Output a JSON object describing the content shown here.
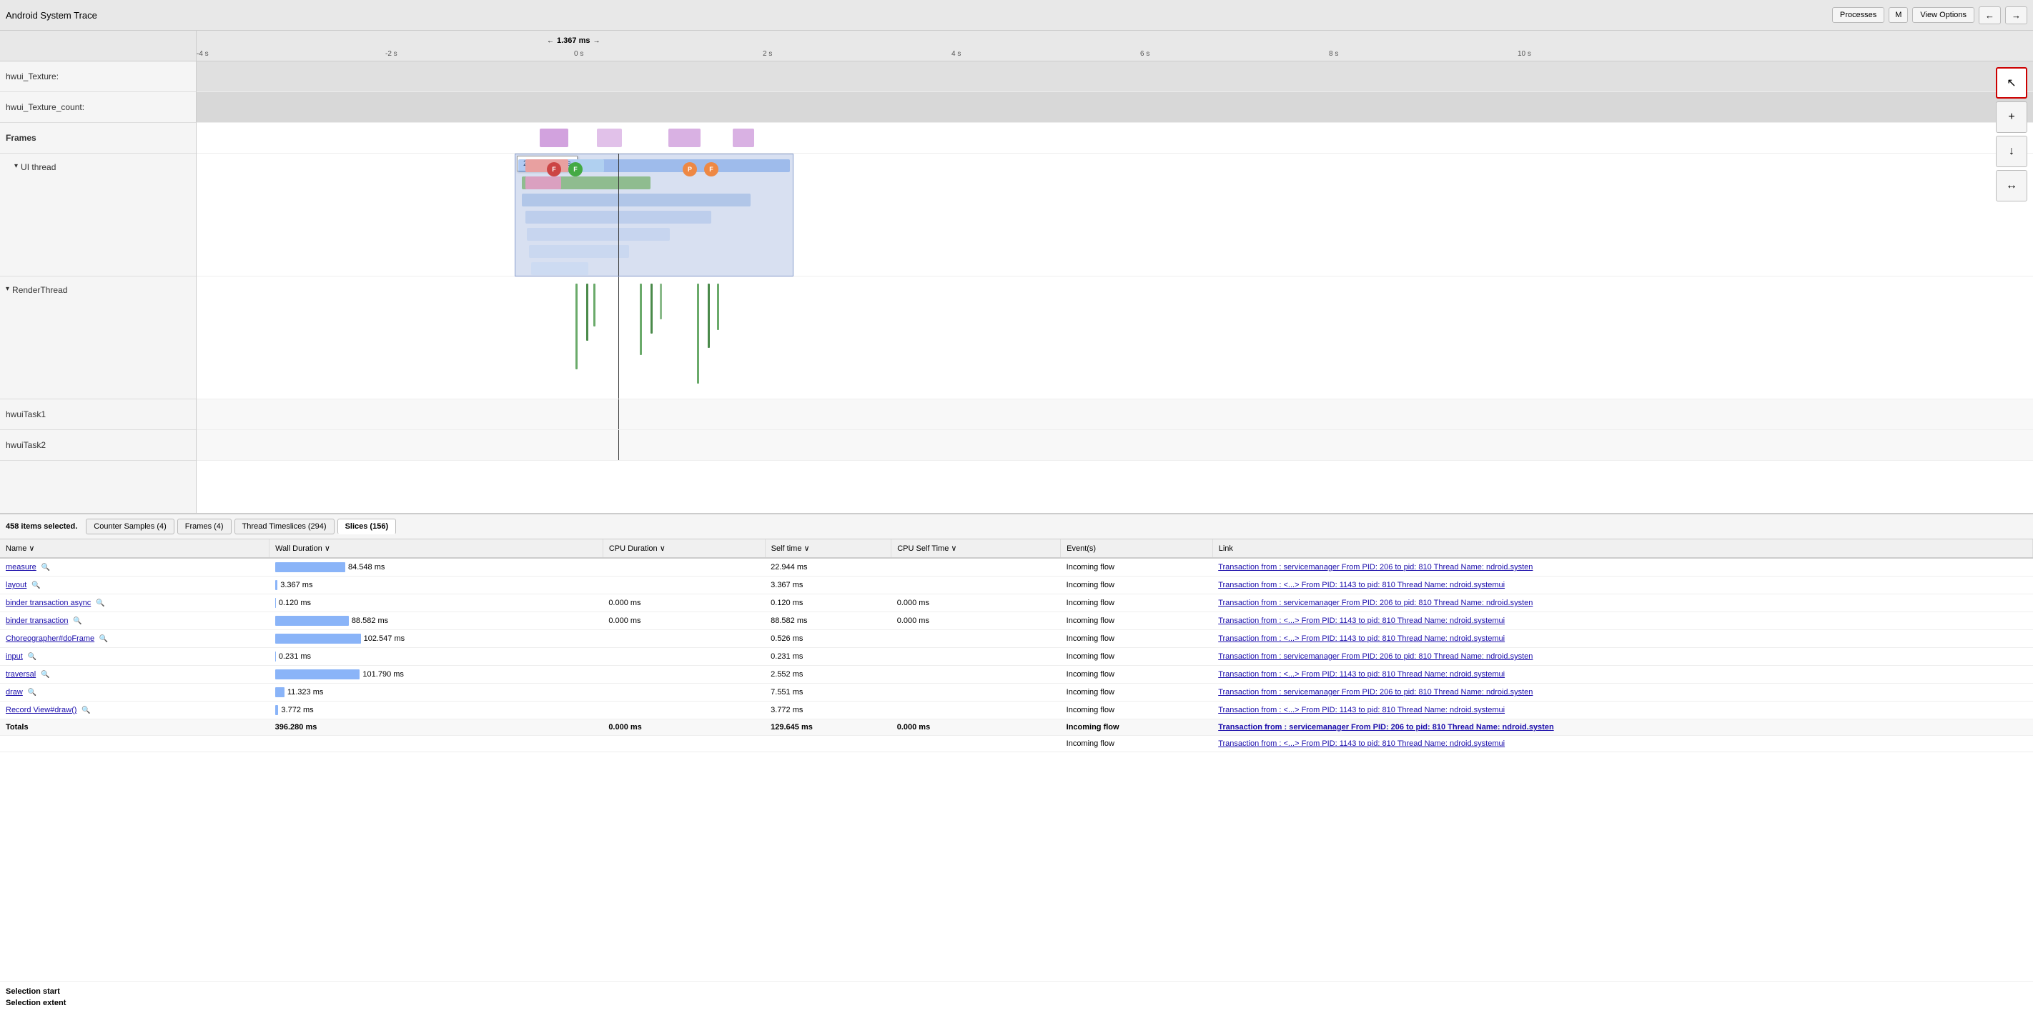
{
  "app": {
    "title": "Android System Trace"
  },
  "topbar": {
    "processes_btn": "Processes",
    "m_btn": "M",
    "view_options_btn": "View Options",
    "back_btn": "←",
    "forward_btn": "→"
  },
  "ruler": {
    "ticks": [
      "-4 s",
      "-2 s",
      "0 s",
      "2 s",
      "4 s",
      "6 s",
      "8 s",
      "10 s"
    ]
  },
  "tracks": [
    {
      "label": "hwui_Texture:",
      "height": "normal"
    },
    {
      "label": "hwui_Texture_count:",
      "height": "normal"
    },
    {
      "label": "Frames",
      "height": "frames",
      "bold": true
    },
    {
      "label": "UI thread",
      "height": "normal",
      "indent": true,
      "arrow": "▾"
    },
    {
      "label": "RenderThread",
      "height": "render",
      "arrow": "▾"
    },
    {
      "label": "hwuiTask1",
      "height": "normal"
    },
    {
      "label": "hwuiTask2",
      "height": "normal"
    }
  ],
  "selection": {
    "summary": "458 items selected.",
    "tabs": [
      {
        "label": "Counter Samples (4)",
        "active": false
      },
      {
        "label": "Frames (4)",
        "active": false
      },
      {
        "label": "Thread Timeslices (294)",
        "active": false
      },
      {
        "label": "Slices (156)",
        "active": true
      }
    ]
  },
  "table": {
    "columns": [
      {
        "label": "Name",
        "sort": true
      },
      {
        "label": "Wall Duration",
        "sort": true
      },
      {
        "label": "CPU Duration",
        "sort": true
      },
      {
        "label": "Self time",
        "sort": true
      },
      {
        "label": "CPU Self Time",
        "sort": true
      },
      {
        "label": "Event(s)",
        "sort": false
      },
      {
        "label": "Link",
        "sort": false
      }
    ],
    "rows": [
      {
        "name": "measure",
        "wall": "84.548 ms",
        "cpu": "",
        "self": "22.944 ms",
        "cpu_self": "",
        "event": "Incoming flow",
        "link": "Transaction from : servicemanager From PID: 206 to pid: 810 Thread Name: ndroid.systen",
        "bar_pct": 82
      },
      {
        "name": "layout",
        "wall": "3.367 ms",
        "cpu": "",
        "self": "3.367 ms",
        "cpu_self": "",
        "event": "Incoming flow",
        "link": "Transaction from : <...> From PID: 1143 to pid: 810 Thread Name: ndroid.systemui",
        "bar_pct": 3
      },
      {
        "name": "binder transaction async",
        "wall": "0.120 ms",
        "cpu": "0.000 ms",
        "self": "0.120 ms",
        "cpu_self": "0.000 ms",
        "event": "Incoming flow",
        "link": "Transaction from : servicemanager From PID: 206 to pid: 810 Thread Name: ndroid.systen",
        "bar_pct": 1
      },
      {
        "name": "binder transaction",
        "wall": "88.582 ms",
        "cpu": "0.000 ms",
        "self": "88.582 ms",
        "cpu_self": "0.000 ms",
        "event": "Incoming flow",
        "link": "Transaction from : <...> From PID: 1143 to pid: 810 Thread Name: ndroid.systemui",
        "bar_pct": 86
      },
      {
        "name": "Choreographer#doFrame",
        "wall": "102.547 ms",
        "cpu": "",
        "self": "0.526 ms",
        "cpu_self": "",
        "event": "Incoming flow",
        "link": "Transaction from : <...> From PID: 1143 to pid: 810 Thread Name: ndroid.systemui",
        "bar_pct": 100
      },
      {
        "name": "input",
        "wall": "0.231 ms",
        "cpu": "",
        "self": "0.231 ms",
        "cpu_self": "",
        "event": "Incoming flow",
        "link": "Transaction from : servicemanager From PID: 206 to pid: 810 Thread Name: ndroid.systen",
        "bar_pct": 1
      },
      {
        "name": "traversal",
        "wall": "101.790 ms",
        "cpu": "",
        "self": "2.552 ms",
        "cpu_self": "",
        "event": "Incoming flow",
        "link": "Transaction from : <...> From PID: 1143 to pid: 810 Thread Name: ndroid.systemui",
        "bar_pct": 99
      },
      {
        "name": "draw",
        "wall": "11.323 ms",
        "cpu": "",
        "self": "7.551 ms",
        "cpu_self": "",
        "event": "Incoming flow",
        "link": "Transaction from : servicemanager From PID: 206 to pid: 810 Thread Name: ndroid.systen",
        "bar_pct": 11
      },
      {
        "name": "Record View#draw()",
        "wall": "3.772 ms",
        "cpu": "",
        "self": "3.772 ms",
        "cpu_self": "",
        "event": "Incoming flow",
        "link": "Transaction from : <...> From PID: 1143 to pid: 810 Thread Name: ndroid.systemui",
        "bar_pct": 4
      },
      {
        "name": "Totals",
        "wall": "396.280 ms",
        "cpu": "0.000 ms",
        "self": "129.645 ms",
        "cpu_self": "0.000 ms",
        "event": "Incoming flow",
        "link": "Transaction from : servicemanager From PID: 206 to pid: 810 Thread Name: ndroid.systen",
        "is_total": true
      },
      {
        "name": "",
        "wall": "",
        "cpu": "",
        "self": "",
        "cpu_self": "",
        "event": "Incoming flow",
        "link": "Transaction from : <...> From PID: 1143 to pid: 810 Thread Name: ndroid.systemui"
      }
    ]
  },
  "bottom_info": [
    {
      "label": "Selection start"
    },
    {
      "label": "Selection extent"
    }
  ],
  "toolbar": {
    "cursor": "↖",
    "zoom_in": "+",
    "zoom_out": "↓",
    "fit": "↔"
  },
  "hover_box": {
    "value": "2,849.274 ms"
  },
  "duration_label": "1.367 ms"
}
